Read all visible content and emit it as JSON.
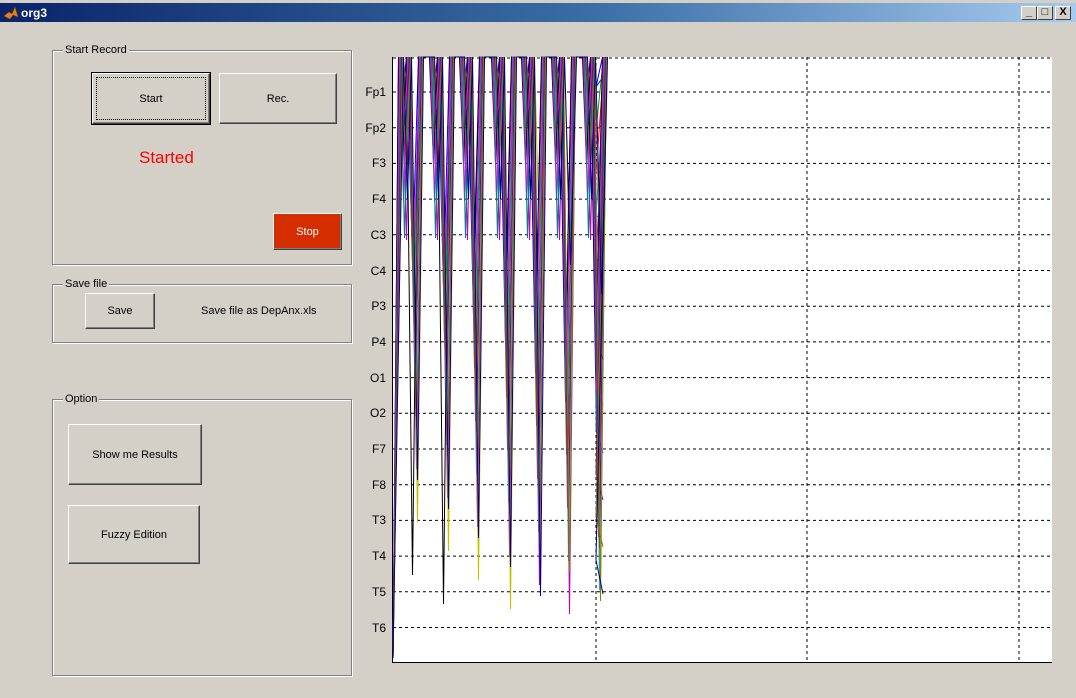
{
  "window": {
    "title": "org3",
    "minimize_glyph": "_",
    "maximize_glyph": "□",
    "close_glyph": "X"
  },
  "start_record": {
    "legend": "Start Record",
    "start_label": "Start",
    "rec_label": "Rec.",
    "status": "Started",
    "stop_label": "Stop",
    "status_color": "#ff0000",
    "stop_color": "#d42d00"
  },
  "save_file": {
    "legend": "Save file",
    "save_label": "Save",
    "hint": "Save file as DepAnx.xls"
  },
  "option": {
    "legend": "Option",
    "results_label": "Show me Results",
    "fuzzy_label": "Fuzzy Edition"
  },
  "plot": {
    "channels": [
      "Fp1",
      "Fp2",
      "F3",
      "F4",
      "C3",
      "C4",
      "P3",
      "P4",
      "O1",
      "O2",
      "F7",
      "F8",
      "T3",
      "T4",
      "T5",
      "T6"
    ],
    "series_colors": [
      "#0000ff",
      "#00a000",
      "#ff0000",
      "#00c0c0",
      "#c000c0",
      "#c0c000",
      "#000000",
      "#ff00ff",
      "#008080",
      "#800080",
      "#808000",
      "#000080"
    ]
  }
}
